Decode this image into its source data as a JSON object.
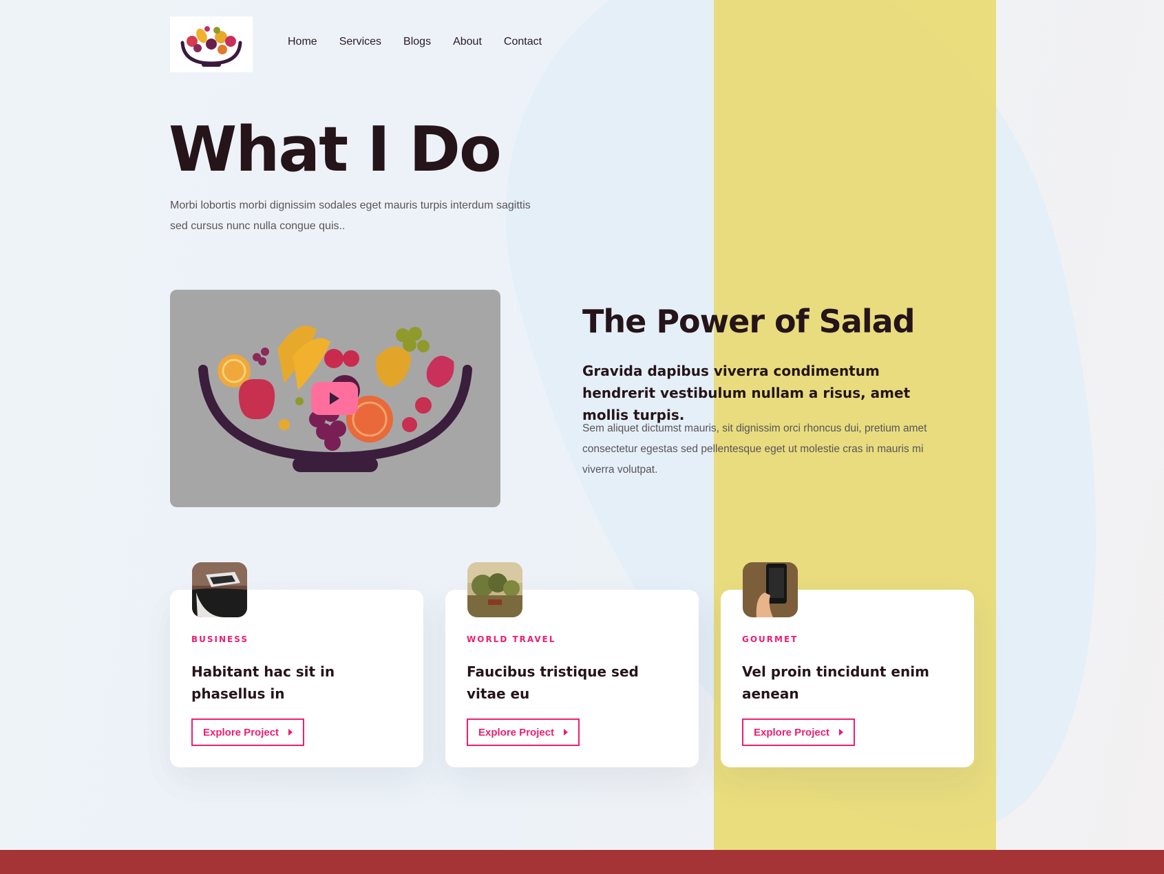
{
  "nav": {
    "items": [
      {
        "label": "Home"
      },
      {
        "label": "Services"
      },
      {
        "label": "Blogs"
      },
      {
        "label": "About"
      },
      {
        "label": "Contact"
      }
    ]
  },
  "hero": {
    "title": "What I Do",
    "subtitle": "Morbi lobortis morbi dignissim sodales eget mauris turpis interdum sagittis sed cursus nunc nulla congue quis.."
  },
  "feature": {
    "title": "The Power of Salad",
    "subtitle": "Gravida dapibus viverra condimentum hendrerit vestibulum nullam a risus, amet mollis turpis.",
    "text": "Sem aliquet dictumst mauris, sit dignissim orci rhoncus dui, pretium amet consectetur egestas sed pellentesque eget ut molestie cras in mauris mi viverra volutpat."
  },
  "cards": [
    {
      "category": "BUSINESS",
      "title": "Habitant hac sit in phasellus in",
      "button": "Explore Project",
      "thumb_icon": "desk-photo"
    },
    {
      "category": "WORLD TRAVEL",
      "title": "Faucibus tristique sed vitae eu",
      "button": "Explore Project",
      "thumb_icon": "landscape-painting"
    },
    {
      "category": "GOURMET",
      "title": "Vel proin tincidunt enim aenean",
      "button": "Explore Project",
      "thumb_icon": "phone-in-hand-photo"
    }
  ],
  "colors": {
    "accent": "#ee1d72",
    "play_button": "#ff6f9d",
    "stripe": "#e8d96c",
    "footer": "#a53436",
    "heading": "#251419"
  }
}
